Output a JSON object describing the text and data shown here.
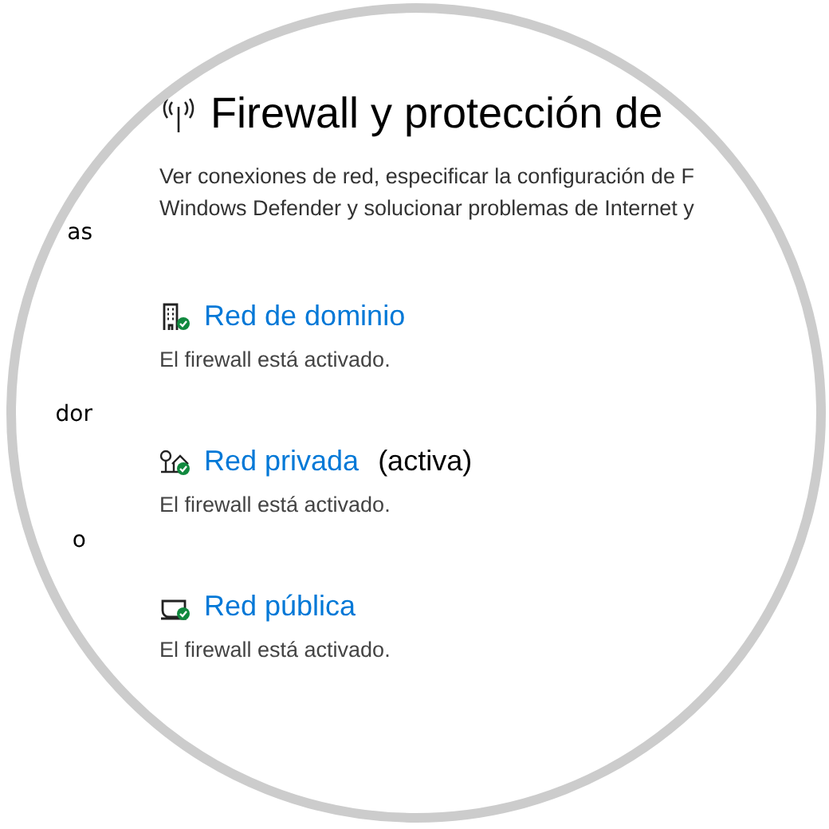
{
  "sidebar": {
    "items": [
      "as",
      "dor",
      "o"
    ]
  },
  "header": {
    "title": "Firewall y protección de",
    "description": [
      "Ver conexiones de red, especificar la configuración de F",
      "Windows Defender y solucionar problemas de Internet y"
    ]
  },
  "networks": [
    {
      "kind": "domain",
      "name": "Red de dominio",
      "status": "El firewall está activado.",
      "protected": true
    },
    {
      "kind": "private",
      "name": "Red privada",
      "suffix": "(activa)",
      "status": "El firewall está activado.",
      "protected": true
    },
    {
      "kind": "public",
      "name": "Red pública",
      "status": "El firewall está activado.",
      "protected": true
    }
  ]
}
